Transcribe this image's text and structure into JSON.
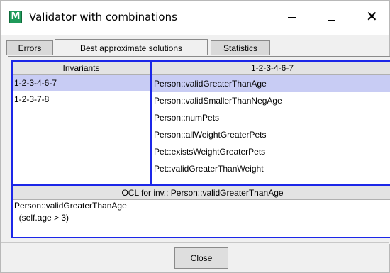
{
  "window": {
    "title": "Validator with combinations",
    "icon": "M"
  },
  "tabs": [
    {
      "label": "Errors",
      "active": false
    },
    {
      "label": "Best approximate solutions",
      "active": true
    },
    {
      "label": "Statistics",
      "active": false
    }
  ],
  "invariants_panel": {
    "header": "Invariants",
    "items": [
      "1-2-3-4-6-7",
      "1-2-3-7-8"
    ],
    "selected_index": 0
  },
  "combination_panel": {
    "header": "1-2-3-4-6-7",
    "items": [
      "Person::validGreaterThanAge",
      "Person::validSmallerThanNegAge",
      "Person::numPets",
      "Person::allWeightGreaterPets",
      "Pet::existsWeightGreaterPets",
      "Pet::validGreaterThanWeight"
    ],
    "selected_index": 0
  },
  "ocl_panel": {
    "header": "OCL for inv.: Person::validGreaterThanAge",
    "lines": [
      "Person::validGreaterThanAge",
      "  (self.age > 3)"
    ]
  },
  "buttons": {
    "close_label": "Close"
  },
  "colors": {
    "panel_border": "#1c27e8",
    "selection": "#c8ccf4",
    "icon": "#1f9a5a"
  }
}
